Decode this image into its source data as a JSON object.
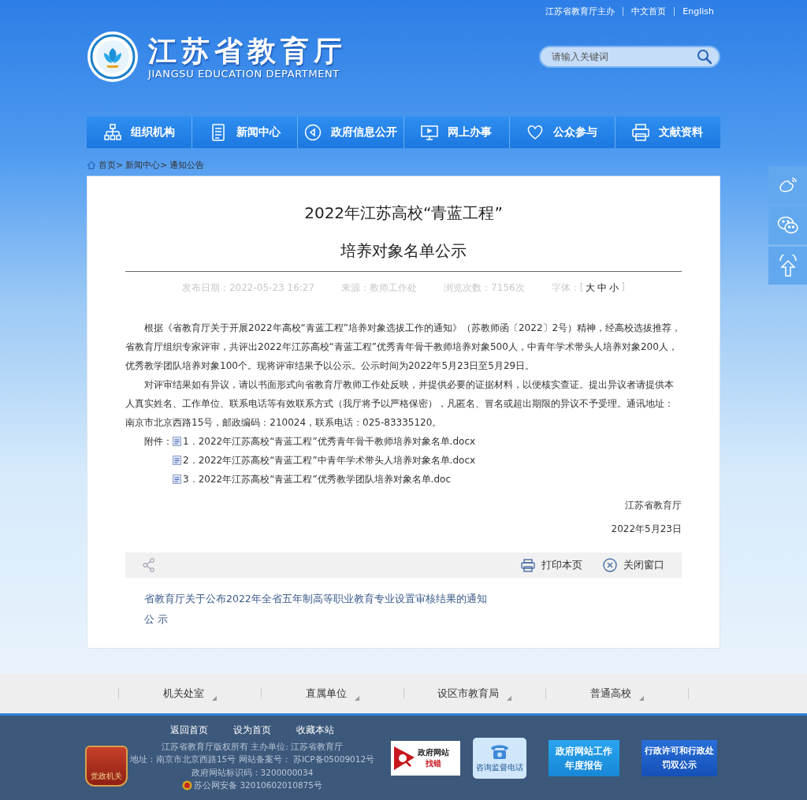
{
  "top_links": [
    "江苏省教育厅主办",
    "中文首页",
    "English"
  ],
  "logo": {
    "title": "江苏省教育厅",
    "subtitle": "JIANGSU EDUCATION DEPARTMENT"
  },
  "search": {
    "placeholder": "请输入关键词"
  },
  "nav": [
    "组织机构",
    "新闻中心",
    "政府信息公开",
    "网上办事",
    "公众参与",
    "文献资料"
  ],
  "breadcrumb": [
    "首页>",
    "新闻中心>",
    "通知公告"
  ],
  "article": {
    "title_lines": [
      "2022年江苏高校“青蓝工程”",
      "培养对象名单公示"
    ],
    "meta": [
      "发布日期：2022-05-23 16:27",
      "来源：教师工作处",
      "浏览次数：7156次"
    ],
    "font_label": "字体：[",
    "font_sizes": [
      "大",
      "中",
      "小"
    ],
    "font_close": "]",
    "paragraphs": [
      "根据《省教育厅关于开展2022年高校“青蓝工程”培养对象选拔工作的通知》（苏教师函〔2022〕2号）精神，经高校选拔推荐，省教育厅组织专家评审，共评出2022年江苏高校“青蓝工程”优秀青年骨干教师培养对象500人，中青年学术带头人培养对象200人，优秀教学团队培养对象100个。现将评审结果予以公示。公示时间为2022年5月23日至5月29日。",
      "对评审结果如有异议，请以书面形式向省教育厅教师工作处反映，并提供必要的证据材料，以便核实查证。提出异议者请提供本人真实姓名、工作单位、联系电话等有效联系方式（我厅将予以严格保密），凡匿名、冒名或超出期限的异议不予受理。通讯地址：南京市北京西路15号，邮政编码：210024，联系电话：025-83335120。"
    ],
    "attachments_label": "附件：",
    "attachments": [
      "1．2022年江苏高校“青蓝工程”优秀青年骨干教师培养对象名单.docx",
      "2．2022年江苏高校“青蓝工程”中青年学术带头人培养对象名单.docx",
      "3．2022年江苏高校“青蓝工程”优秀教学团队培养对象名单.doc"
    ],
    "signature": [
      "江苏省教育厅",
      "2022年5月23日"
    ]
  },
  "actions": [
    "打印本页",
    "关闭窗口"
  ],
  "related": [
    "省教育厅关于公布2022年全省五年制高等职业教育专业设置审核结果的通知",
    "公 示"
  ],
  "footer_nav": [
    "机关处室",
    "直属单位",
    "设区市教育局",
    "普通高校"
  ],
  "footer": {
    "links": [
      "返回首页",
      "设为首页",
      "收藏本站"
    ],
    "info": [
      "江苏省教育厅版权所有 主办单位: 江苏省教育厅",
      "地址：南京市北京西路15号 网站备案号： 苏ICP备05009012号",
      "政府网站标识码：3200000034",
      "苏公网安备 32010602010875号"
    ],
    "party_badge": "党政机关",
    "error_badge": [
      "政府网站",
      "找错"
    ],
    "phone_badge": "咨询监督电话",
    "report_badge": "政府网站工作年度报告",
    "dual_badge": "行政许可和行政处罚双公示"
  }
}
